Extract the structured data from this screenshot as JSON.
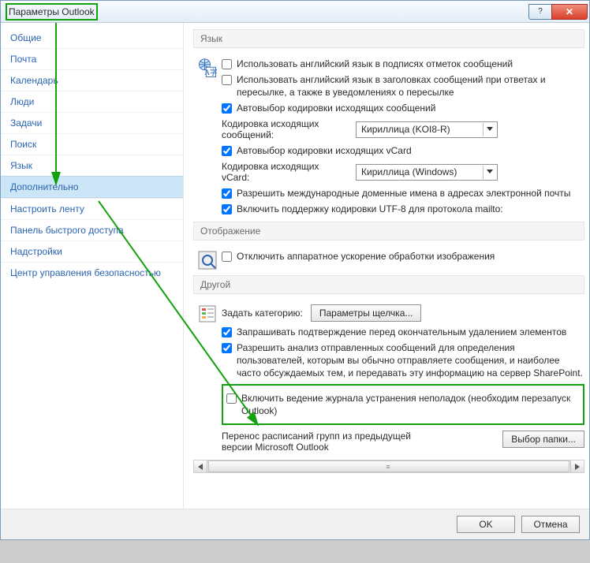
{
  "window": {
    "title": "Параметры Outlook"
  },
  "winbuttons": {
    "help": "?",
    "close": "✕"
  },
  "sidebar": {
    "items": [
      {
        "label": "Общие"
      },
      {
        "label": "Почта"
      },
      {
        "label": "Календарь"
      },
      {
        "label": "Люди"
      },
      {
        "label": "Задачи"
      },
      {
        "label": "Поиск"
      },
      {
        "label": "Язык"
      },
      {
        "label": "Дополнительно",
        "selected": true
      },
      {
        "label": "Настроить ленту"
      },
      {
        "label": "Панель быстрого доступа"
      },
      {
        "label": "Надстройки"
      },
      {
        "label": "Центр управления безопасностью"
      }
    ]
  },
  "sections": {
    "lang": {
      "header": "Язык",
      "chk_sign": "Использовать английский язык в подписях отметок сообщений",
      "chk_hdr": "Использовать английский язык в заголовках сообщений при ответах и пересылке, а также в уведомлениях о пересылке",
      "chk_autoenc": "Автовыбор кодировки исходящих сообщений",
      "lbl_enc": "Кодировка исходящих сообщений:",
      "enc_val": "Кириллица (KOI8-R)",
      "chk_autovcard": "Автовыбор кодировки исходящих vCard",
      "lbl_vcard": "Кодировка исходящих vCard:",
      "vcard_val": "Кириллица (Windows)",
      "chk_idn": "Разрешить международные доменные имена в адресах электронной почты",
      "chk_utf8": "Включить поддержку кодировки UTF-8 для протокола mailto:"
    },
    "display": {
      "header": "Отображение",
      "chk_hw": "Отключить аппаратное ускорение обработки изображения"
    },
    "other": {
      "header": "Другой",
      "lbl_cat": "Задать категорию:",
      "btn_params": "Параметры щелчка...",
      "chk_confirm": "Запрашивать подтверждение перед окончательным удалением элементов",
      "chk_analyze": "Разрешить анализ отправленных сообщений для определения пользователей, которым вы обычно отправляете сообщения, и наиболее часто обсуждаемых тем, и передавать эту информацию на сервер SharePoint.",
      "chk_log": "Включить ведение журнала устранения неполадок (необходим перезапуск Outlook)",
      "lbl_migrate": "Перенос расписаний групп из предыдущей версии Microsoft Outlook",
      "btn_folder": "Выбор папки..."
    }
  },
  "footer": {
    "ok": "OK",
    "cancel": "Отмена"
  },
  "hscroll_dots": "≡"
}
